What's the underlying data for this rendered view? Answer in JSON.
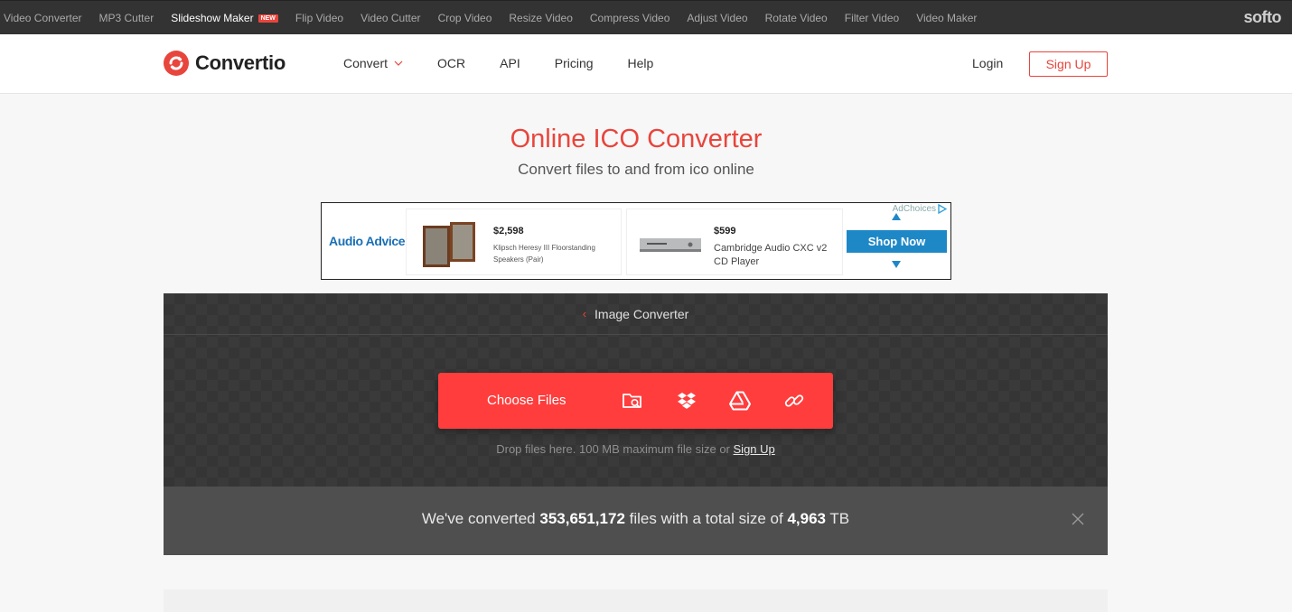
{
  "topbar": {
    "links": [
      {
        "label": "Video Converter",
        "active": false
      },
      {
        "label": "MP3 Cutter",
        "active": false
      },
      {
        "label": "Slideshow Maker",
        "active": true,
        "badge": "NEW"
      },
      {
        "label": "Flip Video",
        "active": false
      },
      {
        "label": "Video Cutter",
        "active": false
      },
      {
        "label": "Crop Video",
        "active": false
      },
      {
        "label": "Resize Video",
        "active": false
      },
      {
        "label": "Compress Video",
        "active": false
      },
      {
        "label": "Adjust Video",
        "active": false
      },
      {
        "label": "Rotate Video",
        "active": false
      },
      {
        "label": "Filter Video",
        "active": false
      },
      {
        "label": "Video Maker",
        "active": false
      }
    ],
    "brand": "softo"
  },
  "header": {
    "logo_text": "Convertio",
    "nav": {
      "convert": "Convert",
      "ocr": "OCR",
      "api": "API",
      "pricing": "Pricing",
      "help": "Help"
    },
    "login": "Login",
    "signup": "Sign Up"
  },
  "hero": {
    "title": "Online ICO Converter",
    "subtitle": "Convert files to and from ico online"
  },
  "ad": {
    "advertiser": "Audio Advice",
    "adchoices": "AdChoices",
    "products": [
      {
        "price": "$2,598",
        "desc": "Klipsch Heresy III Floorstanding Speakers (Pair)"
      },
      {
        "price": "$599",
        "desc": "Cambridge Audio CXC v2 CD Player"
      }
    ],
    "cta": "Shop Now"
  },
  "converter": {
    "breadcrumb": "Image Converter",
    "choose_files": "Choose Files",
    "drop_text": "Drop files here. 100 MB maximum file size or",
    "drop_link": "Sign Up",
    "stats": {
      "prefix": "We've converted",
      "files": "353,651,172",
      "middle": "files with a total size of",
      "size": "4,963",
      "unit": "TB"
    }
  },
  "colors": {
    "accent": "#e8453c",
    "button": "#ff3d3d",
    "ad_cta": "#1e88c7"
  }
}
